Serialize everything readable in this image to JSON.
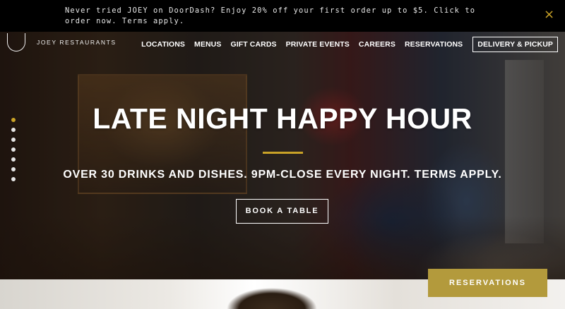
{
  "promo": {
    "text": "Never tried JOEY on DoorDash? Enjoy 20% off your first order up to $5. Click to order now. Terms apply.",
    "close_icon": "×"
  },
  "brand": {
    "name": "JOEY RESTAURANTS"
  },
  "nav": {
    "items": [
      "LOCATIONS",
      "MENUS",
      "GIFT CARDS",
      "PRIVATE EVENTS",
      "CAREERS",
      "RESERVATIONS"
    ],
    "delivery_label": "DELIVERY & PICKUP"
  },
  "hero": {
    "headline": "LATE NIGHT HAPPY HOUR",
    "subheadline": "OVER 30 DRINKS AND DISHES. 9PM-CLOSE EVERY NIGHT. TERMS APPLY.",
    "cta_label": "BOOK A TABLE",
    "slide_count": 7,
    "active_slide": 1
  },
  "floating_reservations_label": "RESERVATIONS",
  "colors": {
    "accent": "#c9a227",
    "button_gold": "#b39a3c",
    "promo_bg": "#000000"
  }
}
